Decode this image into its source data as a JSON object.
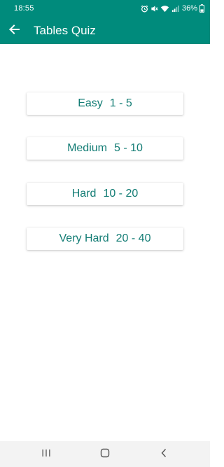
{
  "status_bar": {
    "time": "18:55",
    "battery": "36%",
    "icons": [
      "alarm-icon",
      "mute-icon",
      "wifi-icon",
      "signal-icon",
      "battery-icon"
    ]
  },
  "app_bar": {
    "title": "Tables Quiz",
    "back_icon": "arrow-back-icon"
  },
  "options": [
    {
      "level": "Easy",
      "range": "1 - 5"
    },
    {
      "level": "Medium",
      "range": "5 - 10"
    },
    {
      "level": "Hard",
      "range": "10 - 20"
    },
    {
      "level": "Very Hard",
      "range": "20 - 40"
    }
  ],
  "nav_bar": {
    "icons": [
      "recents-icon",
      "home-icon",
      "back-icon"
    ]
  },
  "colors": {
    "primary": "#008b7c",
    "button_text": "#127c74",
    "background": "#ffffff",
    "nav_background": "#f3f3f3"
  }
}
